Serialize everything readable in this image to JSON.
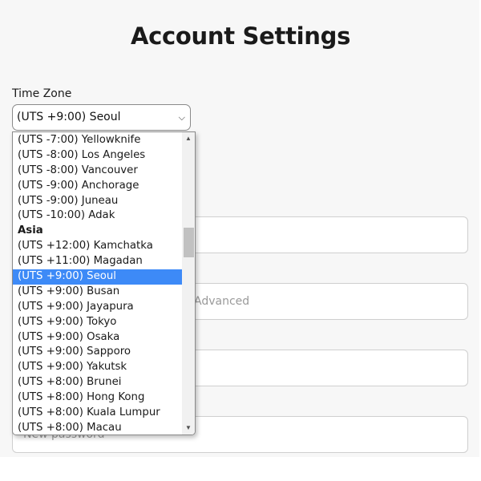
{
  "page": {
    "title": "Account Settings"
  },
  "timezone": {
    "label": "Time Zone",
    "selected": "(UTS +9:00) Seoul",
    "options": [
      {
        "label": "(UTS -7:00) Yellowknife"
      },
      {
        "label": "(UTS -8:00) Los Angeles"
      },
      {
        "label": "(UTS -8:00) Vancouver"
      },
      {
        "label": "(UTS -9:00) Anchorage"
      },
      {
        "label": "(UTS -9:00) Juneau"
      },
      {
        "label": "(UTS -10:00) Adak"
      },
      {
        "label": "Asia",
        "group": true
      },
      {
        "label": "(UTS +12:00) Kamchatka"
      },
      {
        "label": "(UTS +11:00) Magadan"
      },
      {
        "label": "(UTS +9:00) Seoul",
        "selected": true
      },
      {
        "label": "(UTS +9:00) Busan"
      },
      {
        "label": "(UTS +9:00) Jayapura"
      },
      {
        "label": "(UTS +9:00) Tokyo"
      },
      {
        "label": "(UTS +9:00) Osaka"
      },
      {
        "label": "(UTS +9:00) Sapporo"
      },
      {
        "label": "(UTS +9:00) Yakutsk"
      },
      {
        "label": "(UTS +8:00) Brunei"
      },
      {
        "label": "(UTS +8:00) Hong Kong"
      },
      {
        "label": "(UTS +8:00) Kuala Lumpur"
      },
      {
        "label": "(UTS +8:00) Macau"
      }
    ]
  },
  "fields": {
    "field2_placeholder": "Advanced",
    "new_password_placeholder": "New password"
  },
  "icons": {
    "select_chevron": "chevron-down-icon",
    "scroll_up": "scroll-up-arrow-icon",
    "scroll_down": "scroll-down-arrow-icon"
  },
  "colors": {
    "selected_bg": "#3d8af7",
    "selected_text": "#ffffff",
    "panel_bg": "#f7f7f7"
  }
}
